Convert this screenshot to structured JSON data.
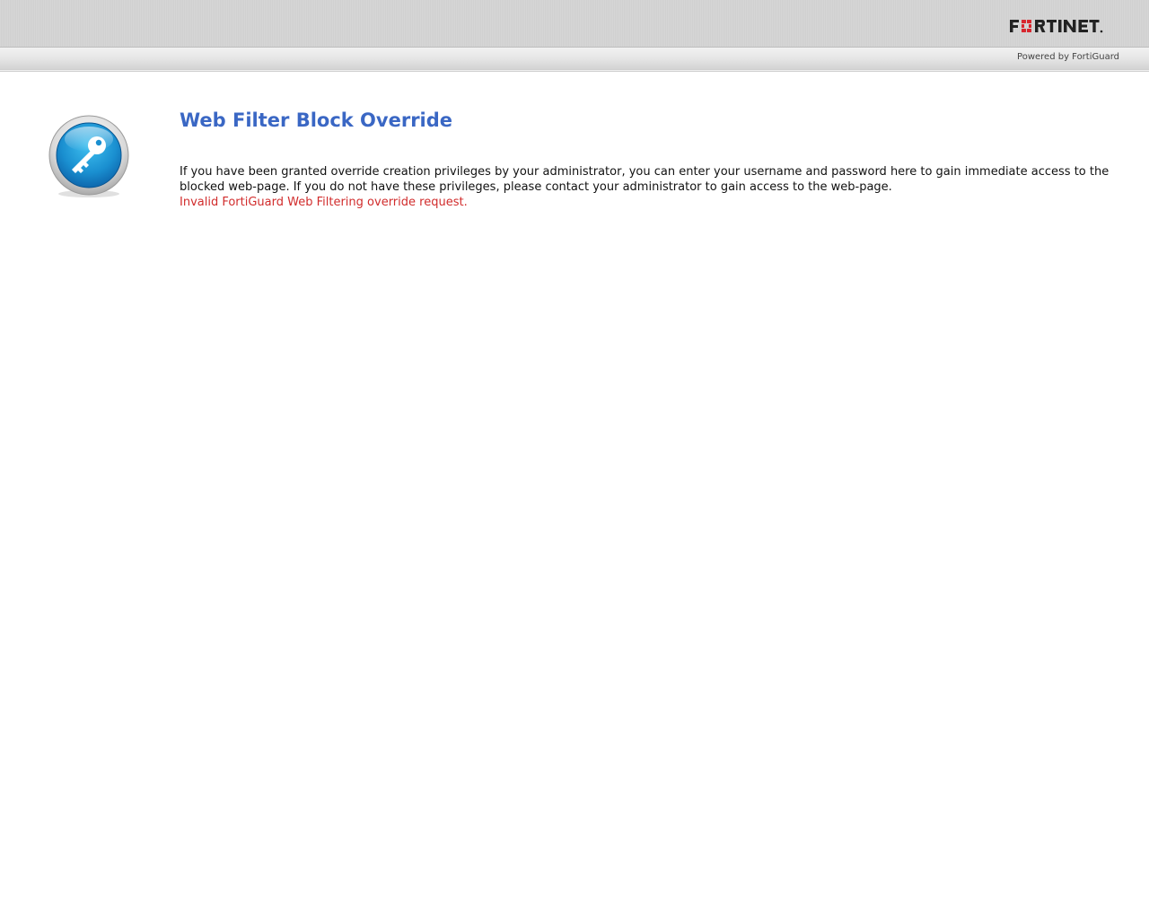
{
  "header": {
    "brand": "FORTINET",
    "tagline": "Powered by FortiGuard"
  },
  "main": {
    "icon": "key-icon",
    "title": "Web Filter Block Override",
    "message": "If you have been granted override creation privileges by your administrator, you can enter your username and password here to gain immediate access to the blocked web-page. If you do not have these privileges, please contact your administrator to gain access to the web-page.",
    "error": "Invalid FortiGuard Web Filtering override request."
  },
  "colors": {
    "title": "#3a67c4",
    "error": "#d12c2c",
    "brand_red": "#d8262e",
    "icon_blue": "#1a9ad6"
  }
}
